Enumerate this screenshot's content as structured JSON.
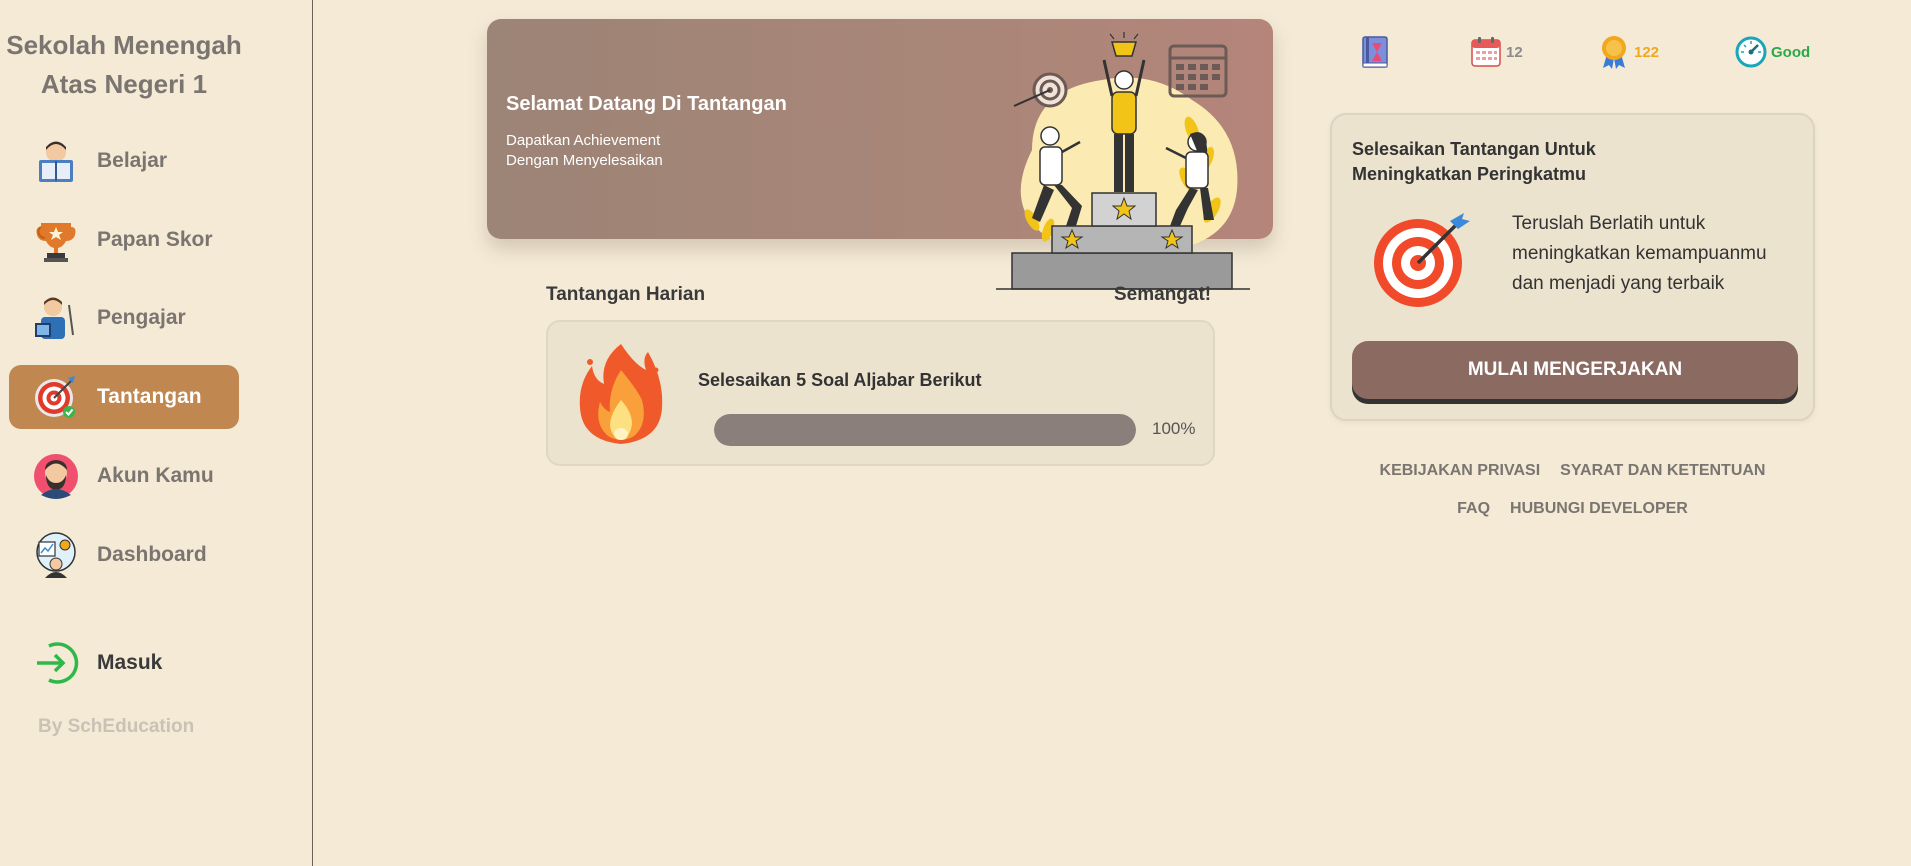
{
  "sidebar": {
    "school_name_line1": "Sekolah Menengah",
    "school_name_line2": "Atas Negeri 1",
    "items": [
      {
        "label": "Belajar",
        "icon": "reading-student-icon"
      },
      {
        "label": "Papan Skor",
        "icon": "trophy-icon"
      },
      {
        "label": "Pengajar",
        "icon": "teacher-icon"
      },
      {
        "label": "Tantangan",
        "icon": "target-icon",
        "active": true
      },
      {
        "label": "Akun Kamu",
        "icon": "user-avatar-icon"
      },
      {
        "label": "Dashboard",
        "icon": "dashboard-icon"
      }
    ],
    "login_label": "Masuk",
    "byline": "By SchEducation"
  },
  "banner": {
    "title": "Selamat Datang Di Tantangan",
    "subtitle_line1": "Dapatkan Achievement",
    "subtitle_line2": "Dengan Menyelesaikan"
  },
  "daily": {
    "section_title": "Tantangan Harian",
    "cheer": "Semangat!",
    "challenge_title": "Selesaikan 5 Soal Aljabar Berikut",
    "progress_percent": 100,
    "progress_text": "100%"
  },
  "stats": {
    "book_icon": "book-icon",
    "calendar_value": "12",
    "medal_value": "122",
    "speed_value": "Good"
  },
  "info_card": {
    "title_line1": "Selesaikan Tantangan Untuk",
    "title_line2": "Meningkatkan Peringkatmu",
    "text_line1": "Teruslah Berlatih untuk",
    "text_line2": "meningkatkan kemampuanmu",
    "text_line3": "dan menjadi yang terbaik",
    "button_label": "MULAI MENGERJAKAN"
  },
  "footer": {
    "privacy": "KEBIJAKAN PRIVASI",
    "terms": "SYARAT DAN KETENTUAN",
    "faq": "FAQ",
    "contact": "HUBUNGI DEVELOPER"
  },
  "colors": {
    "background": "#f4ead6",
    "active_nav": "#c08850",
    "banner": "#a98678",
    "button": "#8b6a62",
    "progress_fill": "#8b7f7c",
    "medal": "#f2a81d",
    "good": "#2aa94a"
  }
}
